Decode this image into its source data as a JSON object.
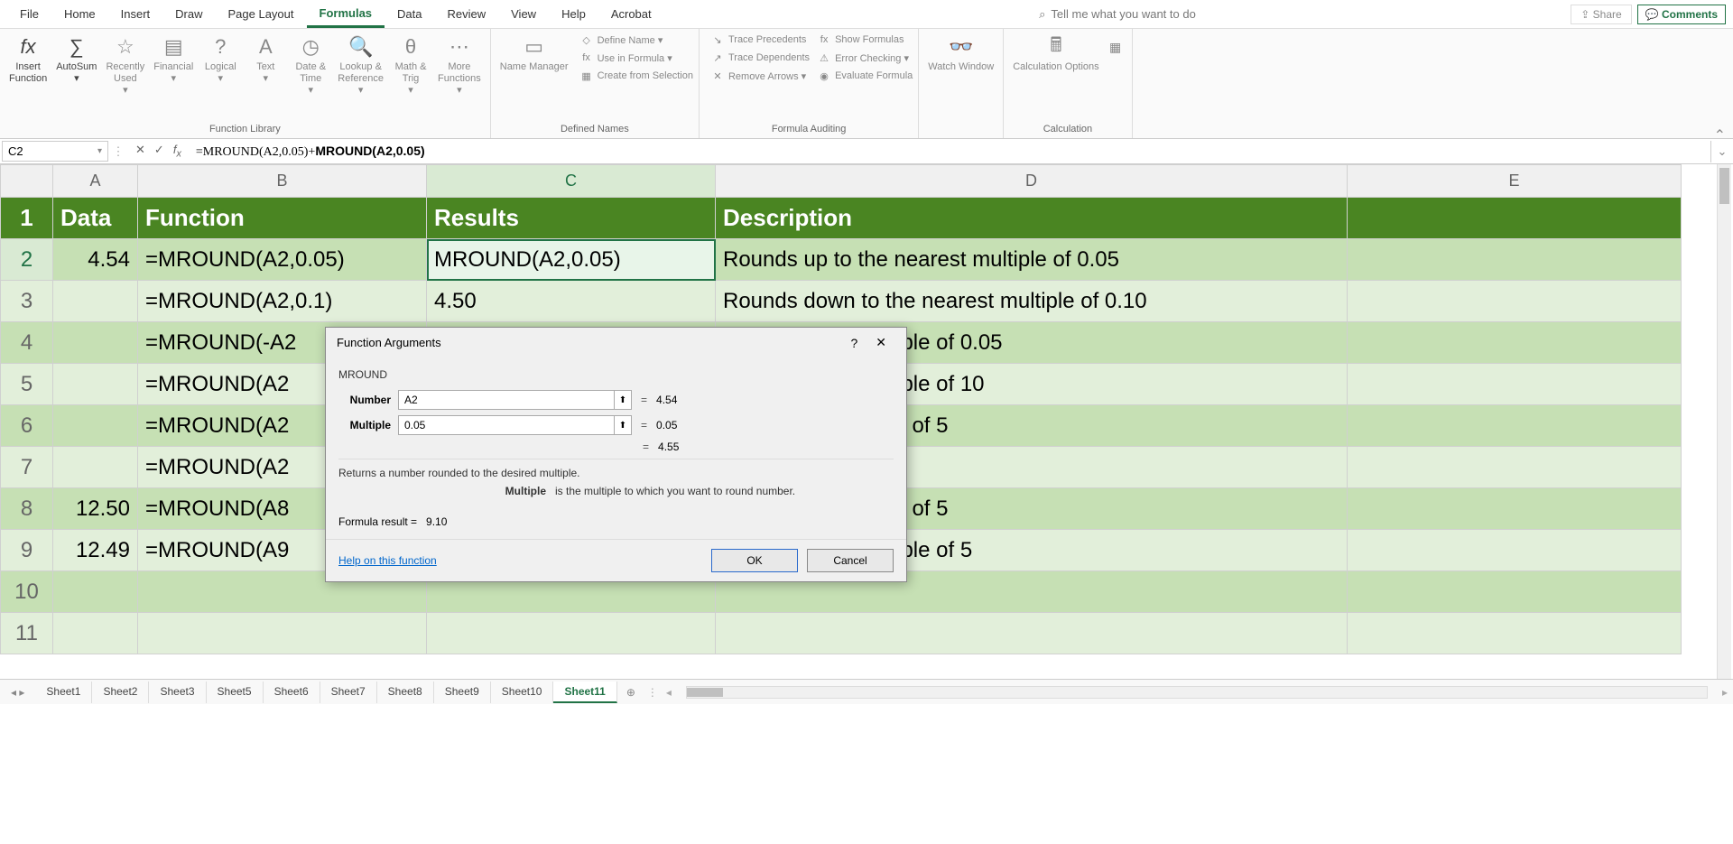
{
  "tabs": [
    "File",
    "Home",
    "Insert",
    "Draw",
    "Page Layout",
    "Formulas",
    "Data",
    "Review",
    "View",
    "Help",
    "Acrobat"
  ],
  "activeTab": "Formulas",
  "search_placeholder": "Tell me what you want to do",
  "share": "Share",
  "comments": "Comments",
  "ribbon": {
    "funcLib": {
      "label": "Function Library",
      "items": [
        "Insert\nFunction",
        "AutoSum",
        "Recently\nUsed",
        "Financial",
        "Logical",
        "Text",
        "Date &\nTime",
        "Lookup &\nReference",
        "Math &\nTrig",
        "More\nFunctions"
      ]
    },
    "defNames": {
      "label": "Defined Names",
      "main": "Name\nManager",
      "side": [
        "Define Name",
        "Use in Formula",
        "Create from Selection"
      ]
    },
    "audit": {
      "label": "Formula Auditing",
      "left": [
        "Trace Precedents",
        "Trace Dependents",
        "Remove Arrows"
      ],
      "right": [
        "Show Formulas",
        "Error Checking",
        "Evaluate Formula"
      ]
    },
    "watch": "Watch\nWindow",
    "calc": {
      "label": "Calculation",
      "main": "Calculation\nOptions"
    }
  },
  "nameBox": "C2",
  "formula": "=MROUND(A2,0.05)+MROUND(A2,0.05)",
  "formulaBold": "MROUND(A2,0.05)",
  "cols": [
    "A",
    "B",
    "C",
    "D",
    "E"
  ],
  "rows": [
    {
      "n": "1",
      "hdr": true,
      "cells": [
        "Data",
        "Function",
        "Results",
        "Description",
        ""
      ]
    },
    {
      "n": "2",
      "cells": [
        "4.54",
        "=MROUND(A2,0.05)",
        "MROUND(A2,0.05)",
        "Rounds up to the nearest multiple of 0.05",
        ""
      ]
    },
    {
      "n": "3",
      "cells": [
        "",
        "=MROUND(A2,0.1)",
        "4.50",
        "Rounds down to the nearest multiple of 0.10",
        ""
      ]
    },
    {
      "n": "4",
      "cells": [
        "",
        "=MROUND(-A2",
        "",
        "o the nearest multiple of 0.05",
        ""
      ]
    },
    {
      "n": "5",
      "cells": [
        "",
        "=MROUND(A2",
        "",
        "o the nearest multiple of 10",
        ""
      ]
    },
    {
      "n": "6",
      "cells": [
        "",
        "=MROUND(A2",
        "",
        "he nearest multiple of 5",
        ""
      ]
    },
    {
      "n": "7",
      "cells": [
        "",
        "=MROUND(A2",
        "",
        "",
        ""
      ]
    },
    {
      "n": "8",
      "cells": [
        "12.50",
        "=MROUND(A8",
        "",
        "he nearest multiple of 5",
        ""
      ]
    },
    {
      "n": "9",
      "cells": [
        "12.49",
        "=MROUND(A9",
        "",
        "o the nearest multiple of 5",
        ""
      ]
    },
    {
      "n": "10",
      "cells": [
        "",
        "",
        "",
        "",
        ""
      ]
    },
    {
      "n": "11",
      "cells": [
        "",
        "",
        "",
        "",
        ""
      ]
    }
  ],
  "sheets": [
    "Sheet1",
    "Sheet2",
    "Sheet3",
    "Sheet5",
    "Sheet6",
    "Sheet7",
    "Sheet8",
    "Sheet9",
    "Sheet10",
    "Sheet11"
  ],
  "activeSheet": "Sheet11",
  "dialog": {
    "title": "Function Arguments",
    "func": "MROUND",
    "args": [
      {
        "label": "Number",
        "value": "A2",
        "res": "4.54"
      },
      {
        "label": "Multiple",
        "value": "0.05",
        "res": "0.05"
      }
    ],
    "preview": "4.55",
    "desc": "Returns a number rounded to the desired multiple.",
    "argName": "Multiple",
    "argDesc": "is the multiple to which you want to round number.",
    "resultLabel": "Formula result =",
    "result": "9.10",
    "help": "Help on this function",
    "ok": "OK",
    "cancel": "Cancel"
  }
}
